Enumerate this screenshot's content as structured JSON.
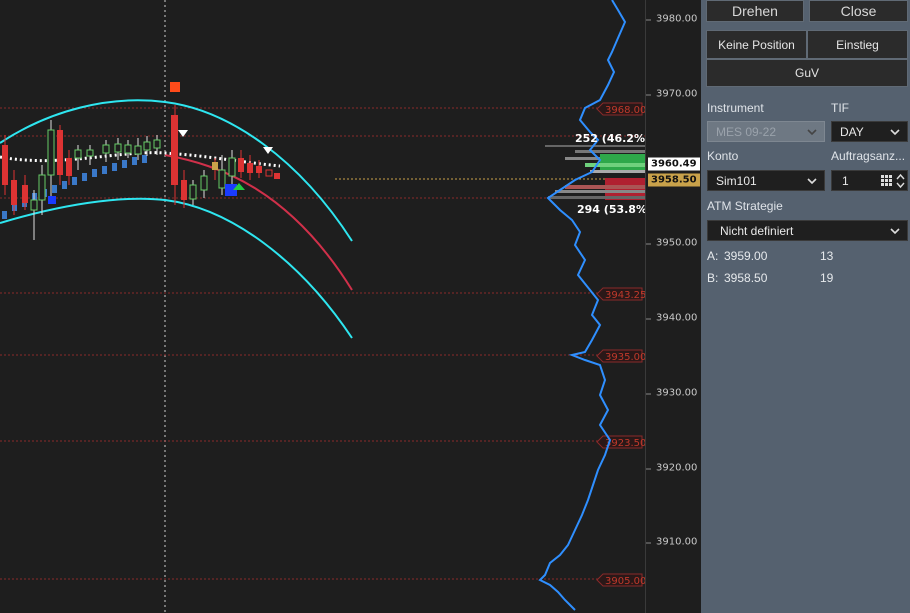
{
  "chart": {
    "price_axis": {
      "ticks": [
        "3980.00",
        "3970.00",
        "3960.00",
        "3950.00",
        "3940.00",
        "3930.00",
        "3920.00",
        "3910.00"
      ],
      "last_price": "3960.49",
      "bid_price": "3958.50"
    },
    "level_labels": [
      "3968.00",
      "3943.25",
      "3935.00",
      "3923.50",
      "3905.00"
    ],
    "volume_stats": {
      "upper": "252  (46.2%)",
      "lower": "294  (53.8%)"
    },
    "colors": {
      "background": "#1e1e1e",
      "band": "#2ee6f0",
      "lower_curve": "#e0304a",
      "price_line": "#2f8fff",
      "level_line": "#c0392b",
      "bid_tag": "#c9a24a",
      "ask_tag": "#ffffff"
    }
  },
  "panel": {
    "buttons": {
      "flip": "Drehen",
      "close": "Close",
      "no_position": "Keine Position",
      "entry": "Einstieg",
      "pnl": "GuV"
    },
    "instrument": {
      "label": "Instrument",
      "value": "MES 09-22"
    },
    "tif": {
      "label": "TIF",
      "value": "DAY"
    },
    "account": {
      "label": "Konto",
      "value": "Sim101"
    },
    "order_qty": {
      "label": "Auftragsanz...",
      "value": "1"
    },
    "atm": {
      "label": "ATM Strategie",
      "value": "Nicht definiert"
    },
    "quotes": {
      "ask_label": "A:",
      "ask_price": "3959.00",
      "ask_size": "13",
      "bid_label": "B:",
      "bid_price": "3958.50",
      "bid_size": "19"
    }
  }
}
